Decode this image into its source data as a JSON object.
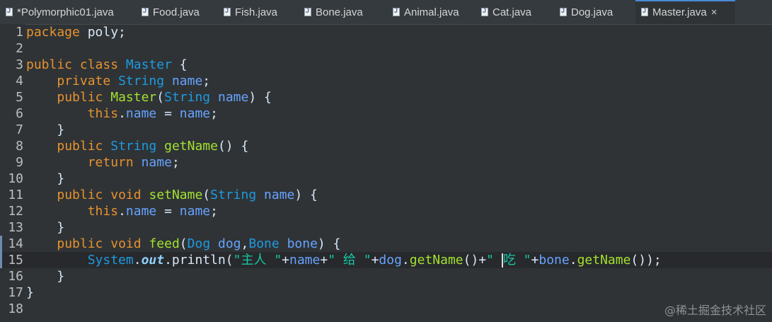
{
  "tabs": [
    {
      "label": "*Polymorphic01.java",
      "active": false
    },
    {
      "label": "Food.java",
      "active": false
    },
    {
      "label": "Fish.java",
      "active": false
    },
    {
      "label": "Bone.java",
      "active": false
    },
    {
      "label": "Animal.java",
      "active": false
    },
    {
      "label": "Cat.java",
      "active": false
    },
    {
      "label": "Dog.java",
      "active": false
    },
    {
      "label": "Master.java",
      "active": true
    }
  ],
  "close_icon": "×",
  "editor": {
    "current_line": 15,
    "lines": [
      {
        "num": "1",
        "tokens": [
          [
            "kw",
            "package"
          ],
          [
            "pl",
            " poly;"
          ]
        ]
      },
      {
        "num": "2",
        "tokens": []
      },
      {
        "num": "3",
        "tokens": [
          [
            "kw",
            "public"
          ],
          [
            "pl",
            " "
          ],
          [
            "kw",
            "class"
          ],
          [
            "pl",
            " "
          ],
          [
            "ty",
            "Master"
          ],
          [
            "pl",
            " {"
          ]
        ]
      },
      {
        "num": "4",
        "tokens": [
          [
            "pl",
            "    "
          ],
          [
            "kw",
            "private"
          ],
          [
            "pl",
            " "
          ],
          [
            "ty",
            "String"
          ],
          [
            "pl",
            " "
          ],
          [
            "vr",
            "name"
          ],
          [
            "pl",
            ";"
          ]
        ]
      },
      {
        "num": "5",
        "tokens": [
          [
            "pl",
            "    "
          ],
          [
            "kw",
            "public"
          ],
          [
            "pl",
            " "
          ],
          [
            "mt",
            "Master"
          ],
          [
            "pl",
            "("
          ],
          [
            "ty",
            "String"
          ],
          [
            "pl",
            " "
          ],
          [
            "vr",
            "name"
          ],
          [
            "pl",
            ") {"
          ]
        ]
      },
      {
        "num": "6",
        "tokens": [
          [
            "pl",
            "        "
          ],
          [
            "kw",
            "this"
          ],
          [
            "pl",
            "."
          ],
          [
            "vr",
            "name"
          ],
          [
            "pl",
            " = "
          ],
          [
            "vr",
            "name"
          ],
          [
            "pl",
            ";"
          ]
        ]
      },
      {
        "num": "7",
        "tokens": [
          [
            "pl",
            "    }"
          ]
        ]
      },
      {
        "num": "8",
        "tokens": [
          [
            "pl",
            "    "
          ],
          [
            "kw",
            "public"
          ],
          [
            "pl",
            " "
          ],
          [
            "ty",
            "String"
          ],
          [
            "pl",
            " "
          ],
          [
            "mt",
            "getName"
          ],
          [
            "pl",
            "() {"
          ]
        ]
      },
      {
        "num": "9",
        "tokens": [
          [
            "pl",
            "        "
          ],
          [
            "kw",
            "return"
          ],
          [
            "pl",
            " "
          ],
          [
            "vr",
            "name"
          ],
          [
            "pl",
            ";"
          ]
        ]
      },
      {
        "num": "10",
        "tokens": [
          [
            "pl",
            "    }"
          ]
        ]
      },
      {
        "num": "11",
        "tokens": [
          [
            "pl",
            "    "
          ],
          [
            "kw",
            "public"
          ],
          [
            "pl",
            " "
          ],
          [
            "kw",
            "void"
          ],
          [
            "pl",
            " "
          ],
          [
            "mt",
            "setName"
          ],
          [
            "pl",
            "("
          ],
          [
            "ty",
            "String"
          ],
          [
            "pl",
            " "
          ],
          [
            "vr",
            "name"
          ],
          [
            "pl",
            ") {"
          ]
        ]
      },
      {
        "num": "12",
        "tokens": [
          [
            "pl",
            "        "
          ],
          [
            "kw",
            "this"
          ],
          [
            "pl",
            "."
          ],
          [
            "vr",
            "name"
          ],
          [
            "pl",
            " = "
          ],
          [
            "vr",
            "name"
          ],
          [
            "pl",
            ";"
          ]
        ]
      },
      {
        "num": "13",
        "tokens": [
          [
            "pl",
            "    }"
          ]
        ]
      },
      {
        "num": "14",
        "tokens": [
          [
            "pl",
            "    "
          ],
          [
            "kw",
            "public"
          ],
          [
            "pl",
            " "
          ],
          [
            "kw",
            "void"
          ],
          [
            "pl",
            " "
          ],
          [
            "mt",
            "feed"
          ],
          [
            "pl",
            "("
          ],
          [
            "ty",
            "Dog"
          ],
          [
            "pl",
            " "
          ],
          [
            "vr",
            "dog"
          ],
          [
            "pl",
            ","
          ],
          [
            "ty",
            "Bone"
          ],
          [
            "pl",
            " "
          ],
          [
            "vr",
            "bone"
          ],
          [
            "pl",
            ") {"
          ]
        ]
      },
      {
        "num": "15",
        "tokens": [
          [
            "pl",
            "        "
          ],
          [
            "ty",
            "System"
          ],
          [
            "pl",
            "."
          ],
          [
            "sf",
            "out"
          ],
          [
            "pl",
            ".println("
          ],
          [
            "st",
            "\"主人 \""
          ],
          [
            "pl",
            "+"
          ],
          [
            "vr",
            "name"
          ],
          [
            "pl",
            "+"
          ],
          [
            "st",
            "\" 给 \""
          ],
          [
            "pl",
            "+"
          ],
          [
            "vr",
            "dog"
          ],
          [
            "pl",
            "."
          ],
          [
            "mt",
            "getName"
          ],
          [
            "pl",
            "()+"
          ],
          [
            "st",
            "\" "
          ],
          [
            "cur",
            ""
          ],
          [
            "st",
            "吃 \""
          ],
          [
            "pl",
            "+"
          ],
          [
            "vr",
            "bone"
          ],
          [
            "pl",
            "."
          ],
          [
            "mt",
            "getName"
          ],
          [
            "pl",
            "());"
          ]
        ]
      },
      {
        "num": "16",
        "tokens": [
          [
            "pl",
            "    }"
          ]
        ]
      },
      {
        "num": "17",
        "tokens": [
          [
            "pl",
            "}"
          ]
        ]
      },
      {
        "num": "18",
        "tokens": []
      }
    ]
  },
  "watermark": "@稀土掘金技术社区"
}
